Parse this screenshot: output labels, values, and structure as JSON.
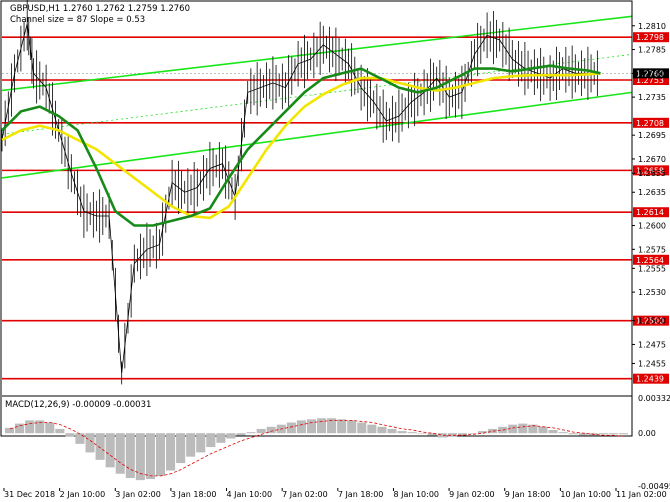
{
  "header": {
    "line1": "GBPUSD,H1  1.2760 1.2762 1.2759 1.2760",
    "line2": "Channel size = 87 Slope = 0.53"
  },
  "macd_label": "MACD(12,26,9) -0.00009 -0.00031",
  "chart_data": {
    "type": "line",
    "symbol": "GBPUSD",
    "timeframe": "H1",
    "ylim": [
      1.2425,
      1.2835
    ],
    "y_ticks": [
      "1.2835",
      "1.2810",
      "1.2785",
      "1.2760",
      "1.2735",
      "1.2695",
      "1.2670",
      "1.2655",
      "1.2635",
      "1.2600",
      "1.2575",
      "1.2555",
      "1.2530",
      "1.2500",
      "1.2475",
      "1.2455",
      "1.2425"
    ],
    "x_labels": [
      "31 Dec 2018",
      "2 Jan 10:00",
      "3 Jan 02:00",
      "3 Jan 18:00",
      "4 Jan 10:00",
      "7 Jan 02:00",
      "7 Jan 18:00",
      "8 Jan 10:00",
      "9 Jan 02:00",
      "9 Jan 18:00",
      "10 Jan 10:00",
      "11 Jan 02:00"
    ],
    "levels": [
      {
        "value": 1.2798,
        "label": "1.2798"
      },
      {
        "value": 1.2753,
        "label": "1.2753"
      },
      {
        "value": 1.2708,
        "label": "1.2708"
      },
      {
        "value": 1.2658,
        "label": "1.2658"
      },
      {
        "value": 1.2614,
        "label": "1.2614"
      },
      {
        "value": 1.2564,
        "label": "1.2564"
      },
      {
        "value": 1.25,
        "label": "1.2500"
      },
      {
        "value": 1.2439,
        "label": "1.2439"
      }
    ],
    "current_price": "1.2760",
    "channel": {
      "x": [
        0,
        100
      ],
      "upper": [
        1.2742,
        1.282
      ],
      "lower": [
        1.265,
        1.274
      ],
      "middle": [
        1.2696,
        1.278
      ]
    },
    "price_series": {
      "x": [
        0,
        2,
        4,
        5,
        7,
        9,
        11,
        13,
        15,
        17,
        19,
        21,
        23,
        25,
        27,
        29,
        31,
        33,
        35,
        37,
        39,
        41,
        43,
        45,
        47,
        49,
        51,
        53,
        55,
        57,
        59,
        61,
        63,
        65,
        67,
        69,
        71,
        73,
        75,
        77,
        79,
        81,
        83,
        85,
        87,
        89,
        91,
        93,
        95
      ],
      "y": [
        1.269,
        1.276,
        1.2812,
        1.276,
        1.2745,
        1.27,
        1.2655,
        1.2615,
        1.261,
        1.261,
        1.2445,
        1.256,
        1.2575,
        1.258,
        1.2645,
        1.2635,
        1.264,
        1.266,
        1.2665,
        1.263,
        1.274,
        1.2745,
        1.275,
        1.2745,
        1.277,
        1.2775,
        1.279,
        1.278,
        1.277,
        1.2745,
        1.273,
        1.271,
        1.2715,
        1.273,
        1.274,
        1.2755,
        1.2735,
        1.274,
        1.278,
        1.28,
        1.2795,
        1.2775,
        1.2765,
        1.276,
        1.2755,
        1.2765,
        1.276,
        1.276,
        1.276
      ]
    },
    "ma_green": {
      "x": [
        0,
        3,
        6,
        9,
        12,
        15,
        18,
        21,
        24,
        27,
        30,
        33,
        36,
        39,
        42,
        45,
        48,
        51,
        54,
        57,
        60,
        63,
        66,
        69,
        72,
        75,
        78,
        81,
        84,
        87,
        90,
        93,
        95
      ],
      "y": [
        1.27,
        1.272,
        1.2725,
        1.2715,
        1.27,
        1.266,
        1.2615,
        1.26,
        1.26,
        1.2605,
        1.261,
        1.2618,
        1.265,
        1.268,
        1.27,
        1.272,
        1.274,
        1.2755,
        1.276,
        1.2765,
        1.2755,
        1.2745,
        1.274,
        1.2745,
        1.2755,
        1.2765,
        1.2765,
        1.2762,
        1.2765,
        1.2768,
        1.2765,
        1.2763,
        1.276
      ]
    },
    "ma_yellow": {
      "x": [
        0,
        3,
        6,
        9,
        12,
        15,
        18,
        21,
        24,
        27,
        30,
        33,
        36,
        39,
        42,
        45,
        48,
        51,
        54,
        57,
        60,
        63,
        66,
        69,
        72,
        75,
        78,
        81,
        84,
        87,
        90,
        93,
        95
      ],
      "y": [
        1.269,
        1.27,
        1.2705,
        1.27,
        1.269,
        1.268,
        1.2665,
        1.265,
        1.2635,
        1.262,
        1.261,
        1.2608,
        1.262,
        1.265,
        1.268,
        1.2705,
        1.2725,
        1.2738,
        1.2748,
        1.2755,
        1.2755,
        1.275,
        1.2745,
        1.2742,
        1.2745,
        1.275,
        1.2755,
        1.2757,
        1.2758,
        1.2758,
        1.2758,
        1.2759,
        1.276
      ]
    },
    "macd": {
      "label": "MACD(12,26,9)",
      "ylim": [
        -0.00495,
        0.0033
      ],
      "y_ticks": [
        "0.00332",
        "0.00",
        "-0.00495"
      ],
      "histogram": [
        0.0005,
        0.0009,
        0.0012,
        0.0012,
        0.001,
        0.0004,
        -0.0003,
        -0.001,
        -0.0018,
        -0.0025,
        -0.0032,
        -0.0038,
        -0.0042,
        -0.0044,
        -0.0043,
        -0.004,
        -0.0035,
        -0.0028,
        -0.0022,
        -0.0018,
        -0.0013,
        -0.0009,
        -0.0005,
        -0.0002,
        0.0001,
        0.0004,
        0.0006,
        0.0008,
        0.001,
        0.0012,
        0.0013,
        0.0014,
        0.0014,
        0.0013,
        0.0012,
        0.001,
        0.0008,
        0.0006,
        0.0004,
        0.0002,
        0.0001,
        0.0,
        -0.0002,
        -0.0004,
        -0.0003,
        -0.0002,
        0.0,
        0.0002,
        0.0004,
        0.0006,
        0.0008,
        0.0009,
        0.0008,
        0.0006,
        0.0003,
        0.0001,
        -0.0001,
        -0.0002,
        -0.0002,
        -0.0001,
        -0.0001,
        -0.0001
      ],
      "signal": [
        0.0004,
        0.0007,
        0.0009,
        0.001,
        0.001,
        0.0008,
        0.0004,
        -0.0001,
        -0.0007,
        -0.0014,
        -0.0021,
        -0.0028,
        -0.0034,
        -0.0038,
        -0.004,
        -0.004,
        -0.0038,
        -0.0034,
        -0.0029,
        -0.0024,
        -0.0019,
        -0.0015,
        -0.0011,
        -0.0007,
        -0.0004,
        -0.0001,
        0.0002,
        0.0004,
        0.0006,
        0.0008,
        0.001,
        0.0011,
        0.0012,
        0.0012,
        0.0012,
        0.0011,
        0.001,
        0.0008,
        0.0006,
        0.0004,
        0.0003,
        0.0001,
        0.0,
        -0.0002,
        -0.0002,
        -0.0002,
        -0.0001,
        0.0,
        0.0002,
        0.0003,
        0.0005,
        0.0006,
        0.0007,
        0.0006,
        0.0005,
        0.0003,
        0.0001,
        0.0,
        -0.0001,
        -0.0002,
        -0.0002,
        -0.0003
      ]
    }
  }
}
